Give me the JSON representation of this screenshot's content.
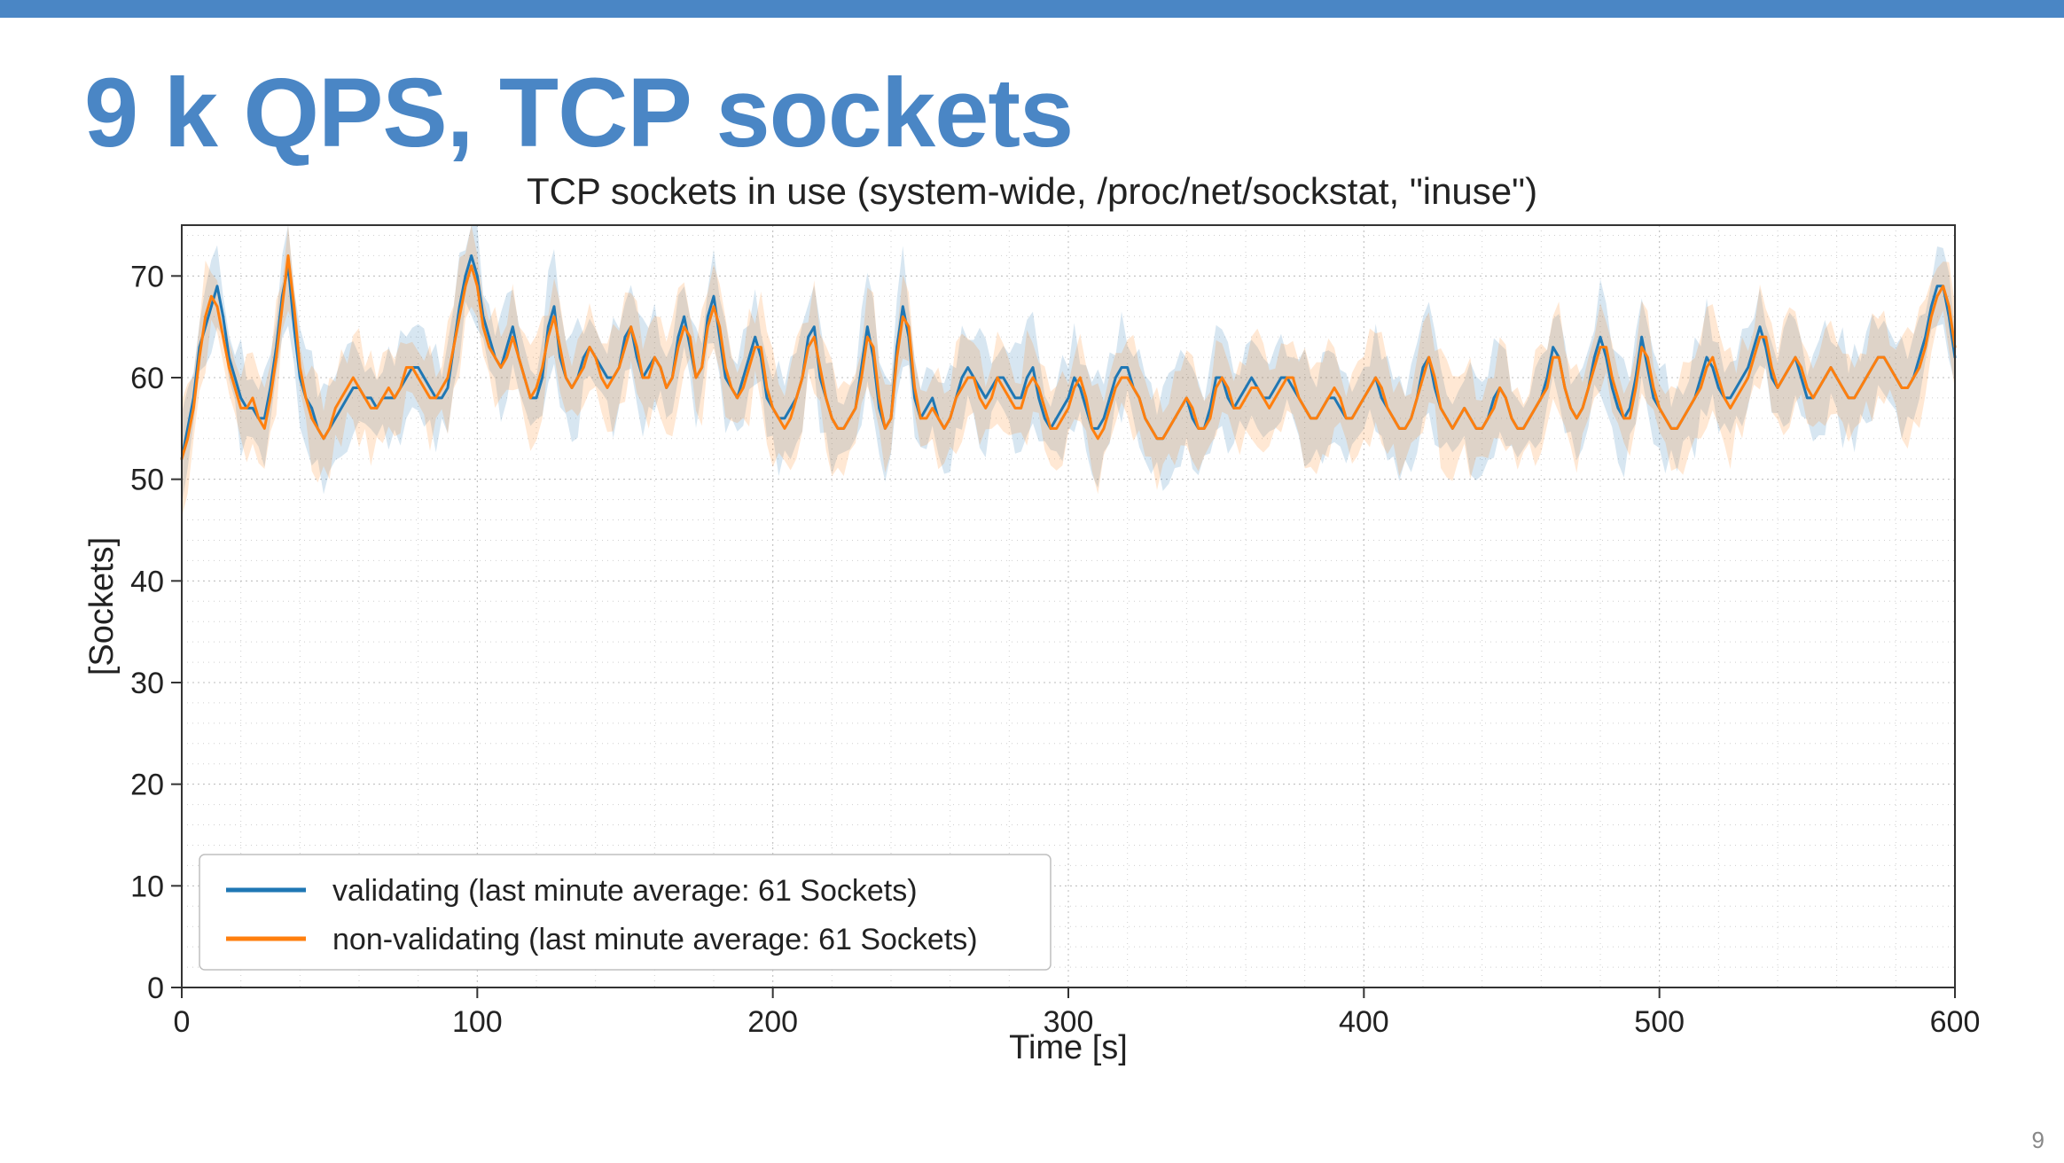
{
  "slide": {
    "title": "9 k QPS, TCP sockets",
    "page_number": "9"
  },
  "chart_data": {
    "type": "line",
    "title": "TCP sockets in use (system-wide, /proc/net/sockstat, \"inuse\")",
    "xlabel": "Time [s]",
    "ylabel": "[Sockets]",
    "xlim": [
      0,
      600
    ],
    "ylim": [
      0,
      75
    ],
    "x_ticks": [
      0,
      100,
      200,
      300,
      400,
      500,
      600
    ],
    "y_ticks": [
      0,
      10,
      20,
      30,
      40,
      50,
      60,
      70
    ],
    "legend_position": "lower-left",
    "colors": {
      "validating": "#1f77b4",
      "non_validating": "#ff7f0e"
    },
    "series": [
      {
        "name": "validating (last minute average: 61 Sockets)",
        "color": "#1f77b4",
        "x_step": 2,
        "values": [
          52,
          55,
          58,
          63,
          65,
          67,
          69,
          66,
          62,
          60,
          58,
          57,
          57,
          56,
          56,
          59,
          63,
          68,
          71,
          65,
          60,
          58,
          57,
          55,
          54,
          55,
          56,
          57,
          58,
          59,
          59,
          58,
          58,
          57,
          58,
          58,
          58,
          59,
          60,
          61,
          61,
          60,
          59,
          58,
          58,
          59,
          63,
          67,
          70,
          72,
          70,
          66,
          64,
          62,
          61,
          63,
          65,
          62,
          60,
          58,
          58,
          60,
          65,
          67,
          62,
          60,
          59,
          60,
          62,
          63,
          62,
          61,
          60,
          60,
          61,
          64,
          65,
          62,
          60,
          61,
          62,
          61,
          59,
          60,
          64,
          66,
          63,
          60,
          61,
          66,
          68,
          64,
          60,
          59,
          58,
          60,
          62,
          64,
          62,
          58,
          57,
          56,
          56,
          57,
          58,
          60,
          64,
          65,
          60,
          58,
          56,
          55,
          55,
          56,
          57,
          61,
          65,
          62,
          57,
          55,
          56,
          63,
          67,
          64,
          58,
          56,
          57,
          58,
          56,
          55,
          56,
          58,
          60,
          61,
          60,
          59,
          58,
          59,
          60,
          60,
          59,
          58,
          58,
          60,
          61,
          58,
          56,
          55,
          56,
          57,
          58,
          60,
          59,
          57,
          55,
          55,
          56,
          58,
          60,
          61,
          61,
          59,
          58,
          56,
          55,
          54,
          54,
          55,
          56,
          57,
          58,
          56,
          55,
          55,
          57,
          60,
          60,
          58,
          57,
          58,
          59,
          60,
          59,
          58,
          58,
          59,
          60,
          60,
          59,
          58,
          57,
          56,
          56,
          57,
          58,
          58,
          57,
          56,
          56,
          57,
          58,
          59,
          60,
          58,
          57,
          56,
          55,
          55,
          56,
          58,
          61,
          62,
          59,
          57,
          56,
          55,
          56,
          57,
          56,
          55,
          55,
          56,
          58,
          59,
          58,
          56,
          55,
          55,
          56,
          57,
          58,
          60,
          63,
          62,
          59,
          57,
          56,
          57,
          59,
          62,
          64,
          62,
          59,
          57,
          56,
          57,
          60,
          64,
          61,
          58,
          57,
          56,
          55,
          55,
          56,
          57,
          58,
          60,
          62,
          61,
          59,
          58,
          58,
          59,
          60,
          61,
          63,
          65,
          63,
          60,
          59,
          60,
          61,
          62,
          60,
          58,
          58,
          59,
          60,
          61,
          60,
          59,
          58,
          58,
          59,
          60,
          61,
          62,
          62,
          61,
          60,
          59,
          59,
          60,
          62,
          64,
          67,
          69,
          69,
          66,
          62
        ]
      },
      {
        "name": "non-validating (last minute average: 61 Sockets)",
        "color": "#ff7f0e",
        "x_step": 2,
        "values": [
          52,
          54,
          57,
          62,
          66,
          68,
          67,
          64,
          61,
          59,
          57,
          57,
          58,
          56,
          55,
          58,
          62,
          67,
          72,
          67,
          61,
          58,
          56,
          55,
          54,
          55,
          57,
          58,
          59,
          60,
          59,
          58,
          57,
          57,
          58,
          59,
          58,
          59,
          61,
          61,
          60,
          59,
          58,
          58,
          59,
          60,
          63,
          66,
          69,
          71,
          69,
          65,
          63,
          62,
          61,
          62,
          64,
          62,
          60,
          58,
          59,
          61,
          64,
          66,
          63,
          60,
          59,
          60,
          61,
          63,
          62,
          60,
          59,
          60,
          61,
          63,
          65,
          63,
          60,
          60,
          62,
          61,
          59,
          60,
          63,
          65,
          64,
          60,
          61,
          65,
          67,
          65,
          61,
          59,
          58,
          59,
          61,
          63,
          63,
          59,
          57,
          56,
          55,
          56,
          58,
          60,
          63,
          64,
          61,
          58,
          56,
          55,
          55,
          56,
          57,
          60,
          64,
          63,
          58,
          55,
          56,
          62,
          66,
          65,
          59,
          56,
          56,
          57,
          56,
          55,
          56,
          58,
          59,
          60,
          60,
          58,
          57,
          58,
          60,
          59,
          58,
          57,
          57,
          59,
          60,
          59,
          57,
          55,
          55,
          56,
          57,
          59,
          60,
          58,
          55,
          54,
          55,
          57,
          59,
          60,
          60,
          59,
          58,
          56,
          55,
          54,
          54,
          55,
          56,
          57,
          58,
          57,
          55,
          55,
          56,
          59,
          60,
          59,
          57,
          57,
          58,
          59,
          59,
          58,
          57,
          58,
          59,
          60,
          60,
          58,
          57,
          56,
          56,
          57,
          58,
          59,
          58,
          56,
          56,
          57,
          58,
          59,
          60,
          59,
          57,
          56,
          55,
          55,
          56,
          58,
          60,
          62,
          60,
          57,
          56,
          55,
          56,
          57,
          56,
          55,
          55,
          56,
          57,
          59,
          58,
          56,
          55,
          55,
          56,
          57,
          58,
          59,
          62,
          62,
          59,
          57,
          56,
          57,
          59,
          61,
          63,
          63,
          60,
          58,
          56,
          56,
          59,
          63,
          62,
          59,
          57,
          56,
          55,
          55,
          56,
          57,
          58,
          59,
          61,
          62,
          60,
          58,
          57,
          58,
          59,
          60,
          62,
          64,
          64,
          61,
          59,
          60,
          61,
          62,
          61,
          59,
          58,
          59,
          60,
          61,
          60,
          59,
          58,
          58,
          59,
          60,
          61,
          62,
          62,
          61,
          60,
          59,
          59,
          60,
          61,
          63,
          66,
          68,
          69,
          67,
          63
        ]
      }
    ]
  }
}
